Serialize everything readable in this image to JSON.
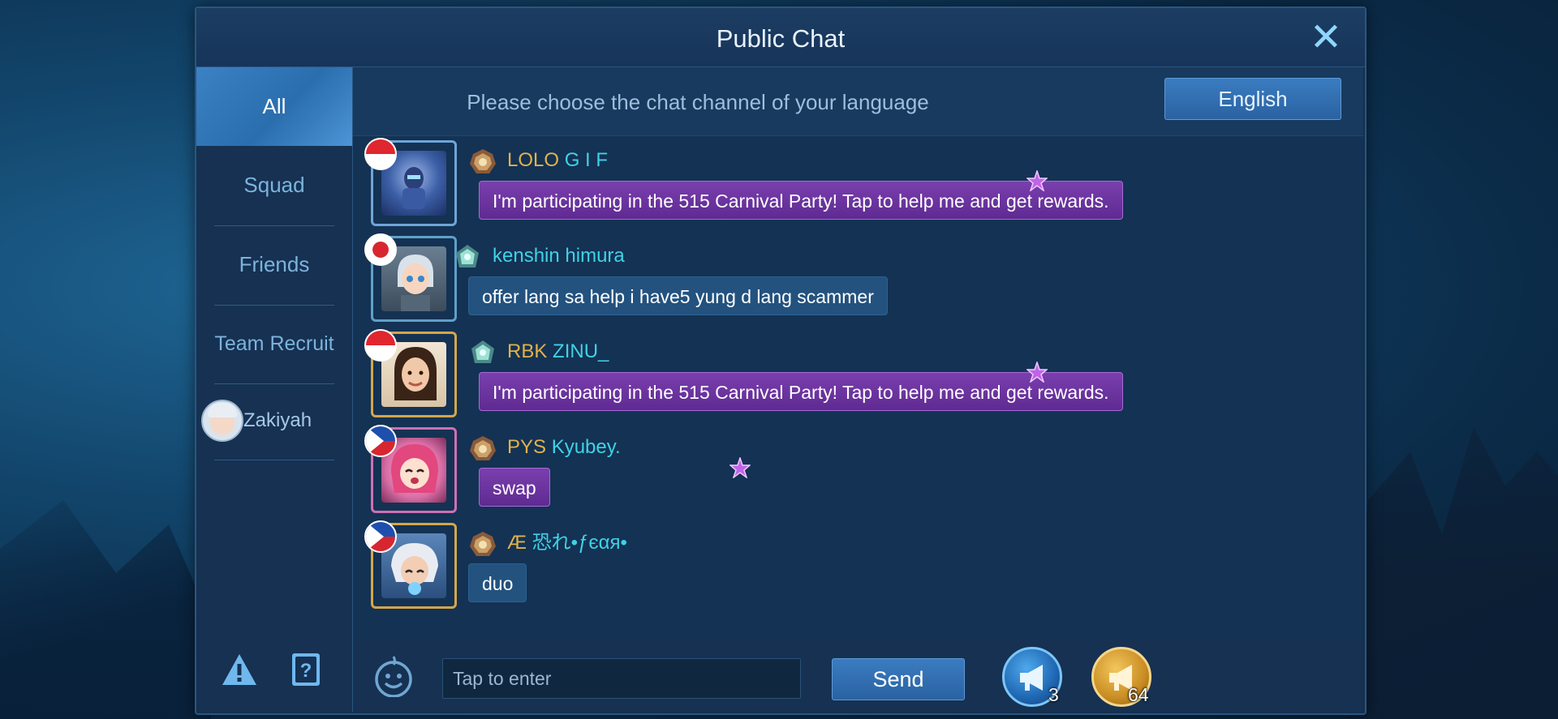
{
  "title": "Public Chat",
  "close_symbol": "✕",
  "sidebar": {
    "tabs": [
      {
        "label": "All",
        "active": true
      },
      {
        "label": "Squad",
        "active": false
      },
      {
        "label": "Friends",
        "active": false
      },
      {
        "label": "Team Recruit",
        "active": false
      }
    ],
    "friend": {
      "name": "Zakiyah"
    },
    "bottom_icons": [
      "warning-icon",
      "help-book-icon"
    ]
  },
  "language_bar": {
    "prompt": "Please choose the chat channel of your language",
    "button_label": "English"
  },
  "messages": [
    {
      "flag": "indonesia",
      "rank": "mythic",
      "clan": "LOLO",
      "nick": "G I F",
      "text": "I'm participating in the 515 Carnival Party! Tap to help me and get rewards.",
      "style": "event"
    },
    {
      "flag": "japan",
      "rank": "epic",
      "clan": "",
      "nick": "kenshin himura",
      "text": "offer lang sa help i have5 yung d lang scammer",
      "style": "normal"
    },
    {
      "flag": "indonesia",
      "rank": "epic",
      "clan": "RBK",
      "nick": "ZINU_",
      "text": "I'm participating in the 515 Carnival Party! Tap to help me and get rewards.",
      "style": "event"
    },
    {
      "flag": "philippines",
      "rank": "mythic",
      "clan": "PYS",
      "nick": "Kyubey.",
      "text": "swap",
      "style": "event"
    },
    {
      "flag": "philippines",
      "rank": "mythic",
      "clan": "Æ",
      "nick": "恐れ•ƒєαя•",
      "text": "duo",
      "style": "normal"
    }
  ],
  "input": {
    "placeholder": "Tap to enter",
    "send_label": "Send"
  },
  "horns": {
    "blue_count": "3",
    "gold_count": "64"
  },
  "colors": {
    "clan": "#e2b24a",
    "nick": "#3fd2e6",
    "event_bubble": "#6b33a0",
    "normal_bubble": "#23527f",
    "accent": "#3a7cc0"
  }
}
